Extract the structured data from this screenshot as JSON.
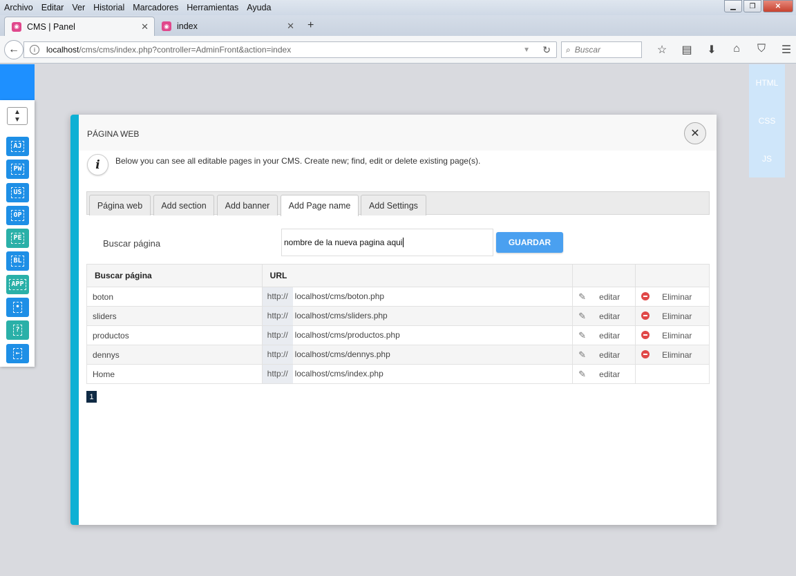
{
  "menubar": [
    "Archivo",
    "Editar",
    "Ver",
    "Historial",
    "Marcadores",
    "Herramientas",
    "Ayuda"
  ],
  "browser_tabs": [
    {
      "title": "CMS | Panel",
      "active": true
    },
    {
      "title": "index",
      "active": false
    }
  ],
  "address": {
    "host": "localhost",
    "path": "/cms/cms/index.php?controller=AdminFront&action=index"
  },
  "search_placeholder": "Buscar",
  "sidebar_items": [
    "AJ",
    "PW",
    "US",
    "OP",
    "PE",
    "BL",
    "APP",
    "•",
    "?",
    "←"
  ],
  "right_tabs": [
    "HTML",
    "CSS",
    "JS"
  ],
  "modal": {
    "title": "PÁGINA WEB",
    "info_icon": "i",
    "info_text": "Below you can see all editable pages in your CMS. Create new; find, edit or delete existing page(s).",
    "tabs": [
      "Página web",
      "Add section",
      "Add banner",
      "Add Page name",
      "Add Settings"
    ],
    "active_tab": "Add Page name",
    "search_label": "Buscar página",
    "input_value": "nombre de la nueva pagina aqui",
    "save_label": "GUARDAR",
    "table": {
      "headers": [
        "Buscar página",
        "URL",
        "",
        ""
      ],
      "rows": [
        {
          "name": "boton",
          "proto": "http://",
          "url": "localhost/cms/boton.php",
          "edit": "editar",
          "delete": "Eliminar"
        },
        {
          "name": "sliders",
          "proto": "http://",
          "url": "localhost/cms/sliders.php",
          "edit": "editar",
          "delete": "Eliminar"
        },
        {
          "name": "productos",
          "proto": "http://",
          "url": "localhost/cms/productos.php",
          "edit": "editar",
          "delete": "Eliminar"
        },
        {
          "name": "dennys",
          "proto": "http://",
          "url": "localhost/cms/dennys.php",
          "edit": "editar",
          "delete": "Eliminar"
        },
        {
          "name": "Home",
          "proto": "http://",
          "url": "localhost/cms/index.php",
          "edit": "editar",
          "delete": ""
        }
      ]
    },
    "page_number": "1"
  },
  "colors": {
    "accent": "#0eb0d4",
    "sidebar_blue": "#1e8fe6",
    "sidebar_teal": "#2ab0a8",
    "save_button": "#4aa0f0",
    "delete_red": "#e04848"
  }
}
